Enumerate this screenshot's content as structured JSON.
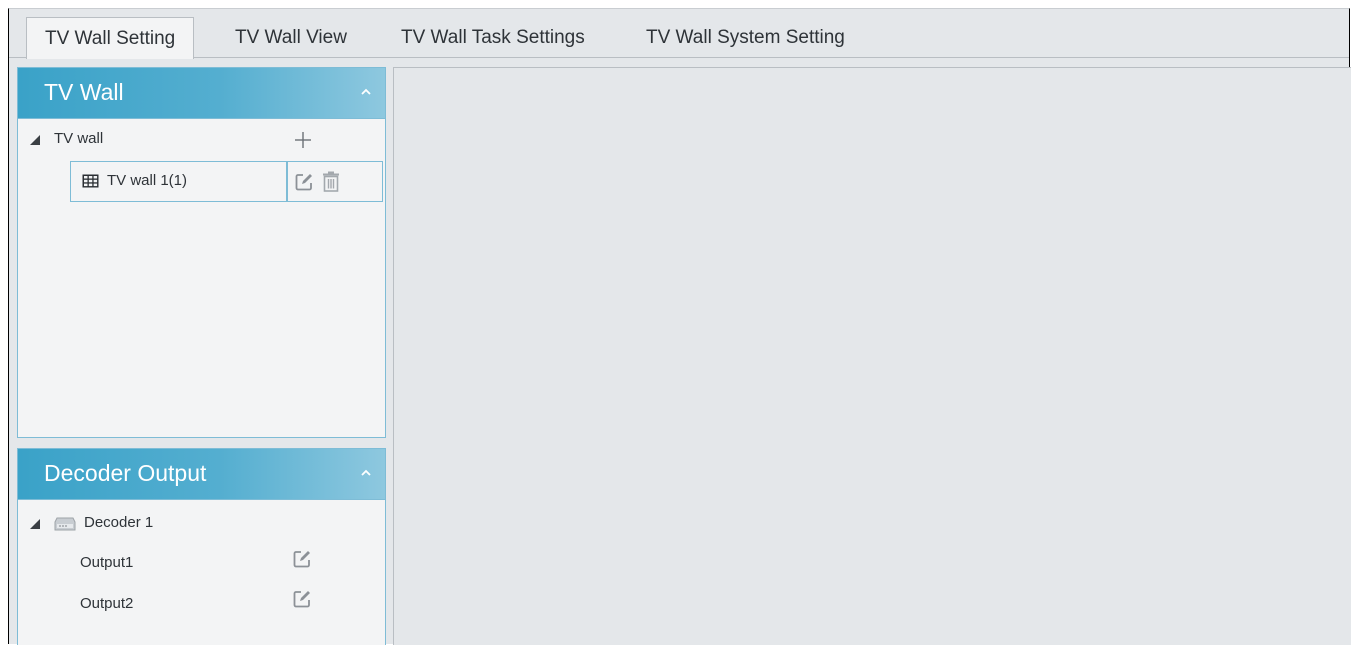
{
  "tabs": [
    {
      "label": "TV Wall Setting",
      "active": true
    },
    {
      "label": "TV Wall View",
      "active": false
    },
    {
      "label": "TV Wall Task Settings",
      "active": false
    },
    {
      "label": "TV Wall System Setting",
      "active": false
    }
  ],
  "tv_wall_panel": {
    "title": "TV Wall",
    "root_label": "TV wall",
    "items": [
      {
        "label": "TV wall 1(1)"
      }
    ]
  },
  "decoder_panel": {
    "title": "Decoder Output",
    "decoder_label": "Decoder 1",
    "outputs": [
      {
        "label": "Output1"
      },
      {
        "label": "Output2"
      }
    ]
  },
  "colors": {
    "header_gradient_start": "#3aa2c8",
    "header_gradient_end": "#8ec8df",
    "panel_border": "#7ebcd6",
    "background": "#e4e7ea"
  }
}
